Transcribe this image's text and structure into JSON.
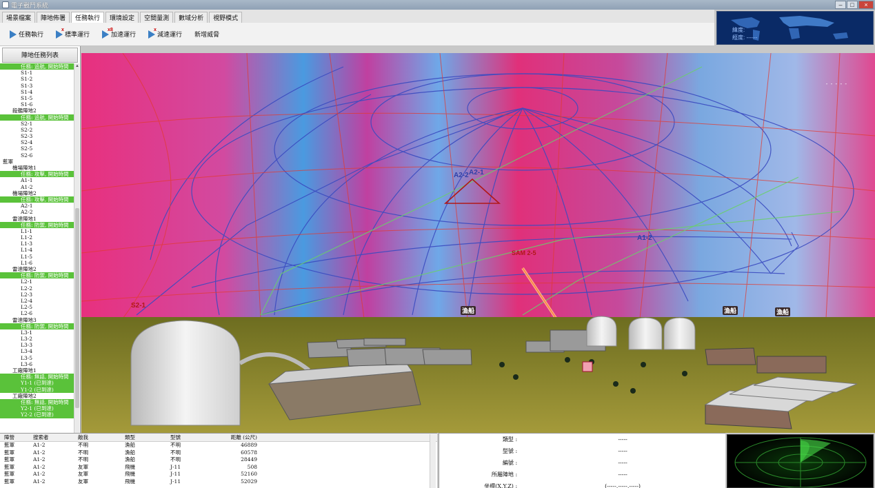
{
  "window": {
    "title": "電子戰鬥系統"
  },
  "menu": {
    "tabs": [
      "場景檔案",
      "陣地佈署",
      "任務執行",
      "環境設定",
      "空間量測",
      "數域分析",
      "視野模式"
    ],
    "active_index": 2
  },
  "toolbar": {
    "buttons": [
      {
        "label": "任務執行",
        "badge": ""
      },
      {
        "label": "標準運行",
        "badge": "x"
      },
      {
        "label": "加速運行",
        "badge": "x8"
      },
      {
        "label": "減速運行",
        "badge": "x"
      },
      {
        "label": "新增威脅",
        "badge": ""
      }
    ]
  },
  "worldmap": {
    "label1": "緯度:",
    "label2": "經度: ------"
  },
  "left_panel": {
    "header": "陣地任務列表"
  },
  "tree": [
    {
      "t": "任務: 追航, 開始時間",
      "k": "task",
      "l": 2
    },
    {
      "t": "S1-1",
      "k": "",
      "l": 2
    },
    {
      "t": "S1-2",
      "k": "",
      "l": 2
    },
    {
      "t": "S1-3",
      "k": "",
      "l": 2
    },
    {
      "t": "S1-4",
      "k": "",
      "l": 2
    },
    {
      "t": "S1-5",
      "k": "",
      "l": 2
    },
    {
      "t": "S1-6",
      "k": "",
      "l": 2
    },
    {
      "t": "殺艦陣地2",
      "k": "",
      "l": 1
    },
    {
      "t": "任務: 追航, 開始時間",
      "k": "task",
      "l": 2
    },
    {
      "t": "S2-1",
      "k": "",
      "l": 2
    },
    {
      "t": "S2-2",
      "k": "",
      "l": 2
    },
    {
      "t": "S2-3",
      "k": "",
      "l": 2
    },
    {
      "t": "S2-4",
      "k": "",
      "l": 2
    },
    {
      "t": "S2-5",
      "k": "",
      "l": 2
    },
    {
      "t": "S2-6",
      "k": "",
      "l": 2
    },
    {
      "t": "藍軍",
      "k": "",
      "l": 0
    },
    {
      "t": "機場陣地1",
      "k": "",
      "l": 1
    },
    {
      "t": "任務: 攻擊, 開始時間",
      "k": "task",
      "l": 2
    },
    {
      "t": "A1-1",
      "k": "",
      "l": 2
    },
    {
      "t": "A1-2",
      "k": "",
      "l": 2
    },
    {
      "t": "機場陣地2",
      "k": "",
      "l": 1
    },
    {
      "t": "任務: 攻擊, 開始時間",
      "k": "task",
      "l": 2
    },
    {
      "t": "A2-1",
      "k": "",
      "l": 2
    },
    {
      "t": "A2-2",
      "k": "",
      "l": 2
    },
    {
      "t": "雷達陣地1",
      "k": "",
      "l": 1
    },
    {
      "t": "任務: 防禦, 開始時間",
      "k": "task",
      "l": 2
    },
    {
      "t": "L1-1",
      "k": "",
      "l": 2
    },
    {
      "t": "L1-2",
      "k": "",
      "l": 2
    },
    {
      "t": "L1-3",
      "k": "",
      "l": 2
    },
    {
      "t": "L1-4",
      "k": "",
      "l": 2
    },
    {
      "t": "L1-5",
      "k": "",
      "l": 2
    },
    {
      "t": "L1-6",
      "k": "",
      "l": 2
    },
    {
      "t": "雷達陣地2",
      "k": "",
      "l": 1
    },
    {
      "t": "任務: 防禦, 開始時間",
      "k": "task",
      "l": 2
    },
    {
      "t": "L2-1",
      "k": "",
      "l": 2
    },
    {
      "t": "L2-2",
      "k": "",
      "l": 2
    },
    {
      "t": "L2-3",
      "k": "",
      "l": 2
    },
    {
      "t": "L2-4",
      "k": "",
      "l": 2
    },
    {
      "t": "L2-5",
      "k": "",
      "l": 2
    },
    {
      "t": "L2-6",
      "k": "",
      "l": 2
    },
    {
      "t": "雷達陣地3",
      "k": "",
      "l": 1
    },
    {
      "t": "任務: 防禦, 開始時間",
      "k": "task",
      "l": 2
    },
    {
      "t": "L3-1",
      "k": "",
      "l": 2
    },
    {
      "t": "L3-2",
      "k": "",
      "l": 2
    },
    {
      "t": "L3-3",
      "k": "",
      "l": 2
    },
    {
      "t": "L3-4",
      "k": "",
      "l": 2
    },
    {
      "t": "L3-5",
      "k": "",
      "l": 2
    },
    {
      "t": "L3-6",
      "k": "",
      "l": 2
    },
    {
      "t": "工廠陣地1",
      "k": "",
      "l": 1
    },
    {
      "t": "任務: 無話, 開始時間",
      "k": "task",
      "l": 2
    },
    {
      "t": "Y1-1 (已到達)",
      "k": "task",
      "l": 2
    },
    {
      "t": "Y1-2 (已到達)",
      "k": "task",
      "l": 2
    },
    {
      "t": "工廠陣地2",
      "k": "",
      "l": 1
    },
    {
      "t": "任務: 無話, 開始時間",
      "k": "task",
      "l": 2
    },
    {
      "t": "Y2-1 (已到達)",
      "k": "task",
      "l": 2
    },
    {
      "t": "Y2-2 (已到達)",
      "k": "task",
      "l": 2
    }
  ],
  "viewport_labels": {
    "a2_1": "A2-1",
    "a2_2": "A2-2",
    "a1_2": "A1-2",
    "sam": "SAM 2-5",
    "s2_1": "S2-1",
    "tag1": "漁船",
    "tag2": "漁船",
    "tag3": "漁船",
    "hud": "- - - - -"
  },
  "table": {
    "headers": [
      "陣營",
      "搜索者",
      "敵我",
      "類型",
      "型號",
      "距離 (公尺)"
    ],
    "rows": [
      [
        "藍軍",
        "A1-2",
        "不明",
        "漁船",
        "不明",
        "46889"
      ],
      [
        "藍軍",
        "A1-2",
        "不明",
        "漁船",
        "不明",
        "60578"
      ],
      [
        "藍軍",
        "A1-2",
        "不明",
        "漁船",
        "不明",
        "28449"
      ],
      [
        "藍軍",
        "A1-2",
        "友軍",
        "飛機",
        "J-11",
        "508"
      ],
      [
        "藍軍",
        "A1-2",
        "友軍",
        "飛機",
        "J-11",
        "52160"
      ],
      [
        "藍軍",
        "A1-2",
        "友軍",
        "飛機",
        "J-11",
        "52029"
      ]
    ]
  },
  "info": {
    "rows": [
      {
        "k": "類型 :",
        "v": "-----"
      },
      {
        "k": "型號 :",
        "v": "-----"
      },
      {
        "k": "編號 :",
        "v": "-----"
      },
      {
        "k": "所屬陣地 :",
        "v": "-----"
      },
      {
        "k": "坐標(X,Y,Z) :",
        "v": "(-----,-----,-----)"
      }
    ]
  },
  "colors": {
    "task_green": "#5ac23a",
    "sky_pink": "#e0307a",
    "sky_blue": "#5aa0e0",
    "ground": "#8a8a2a"
  }
}
